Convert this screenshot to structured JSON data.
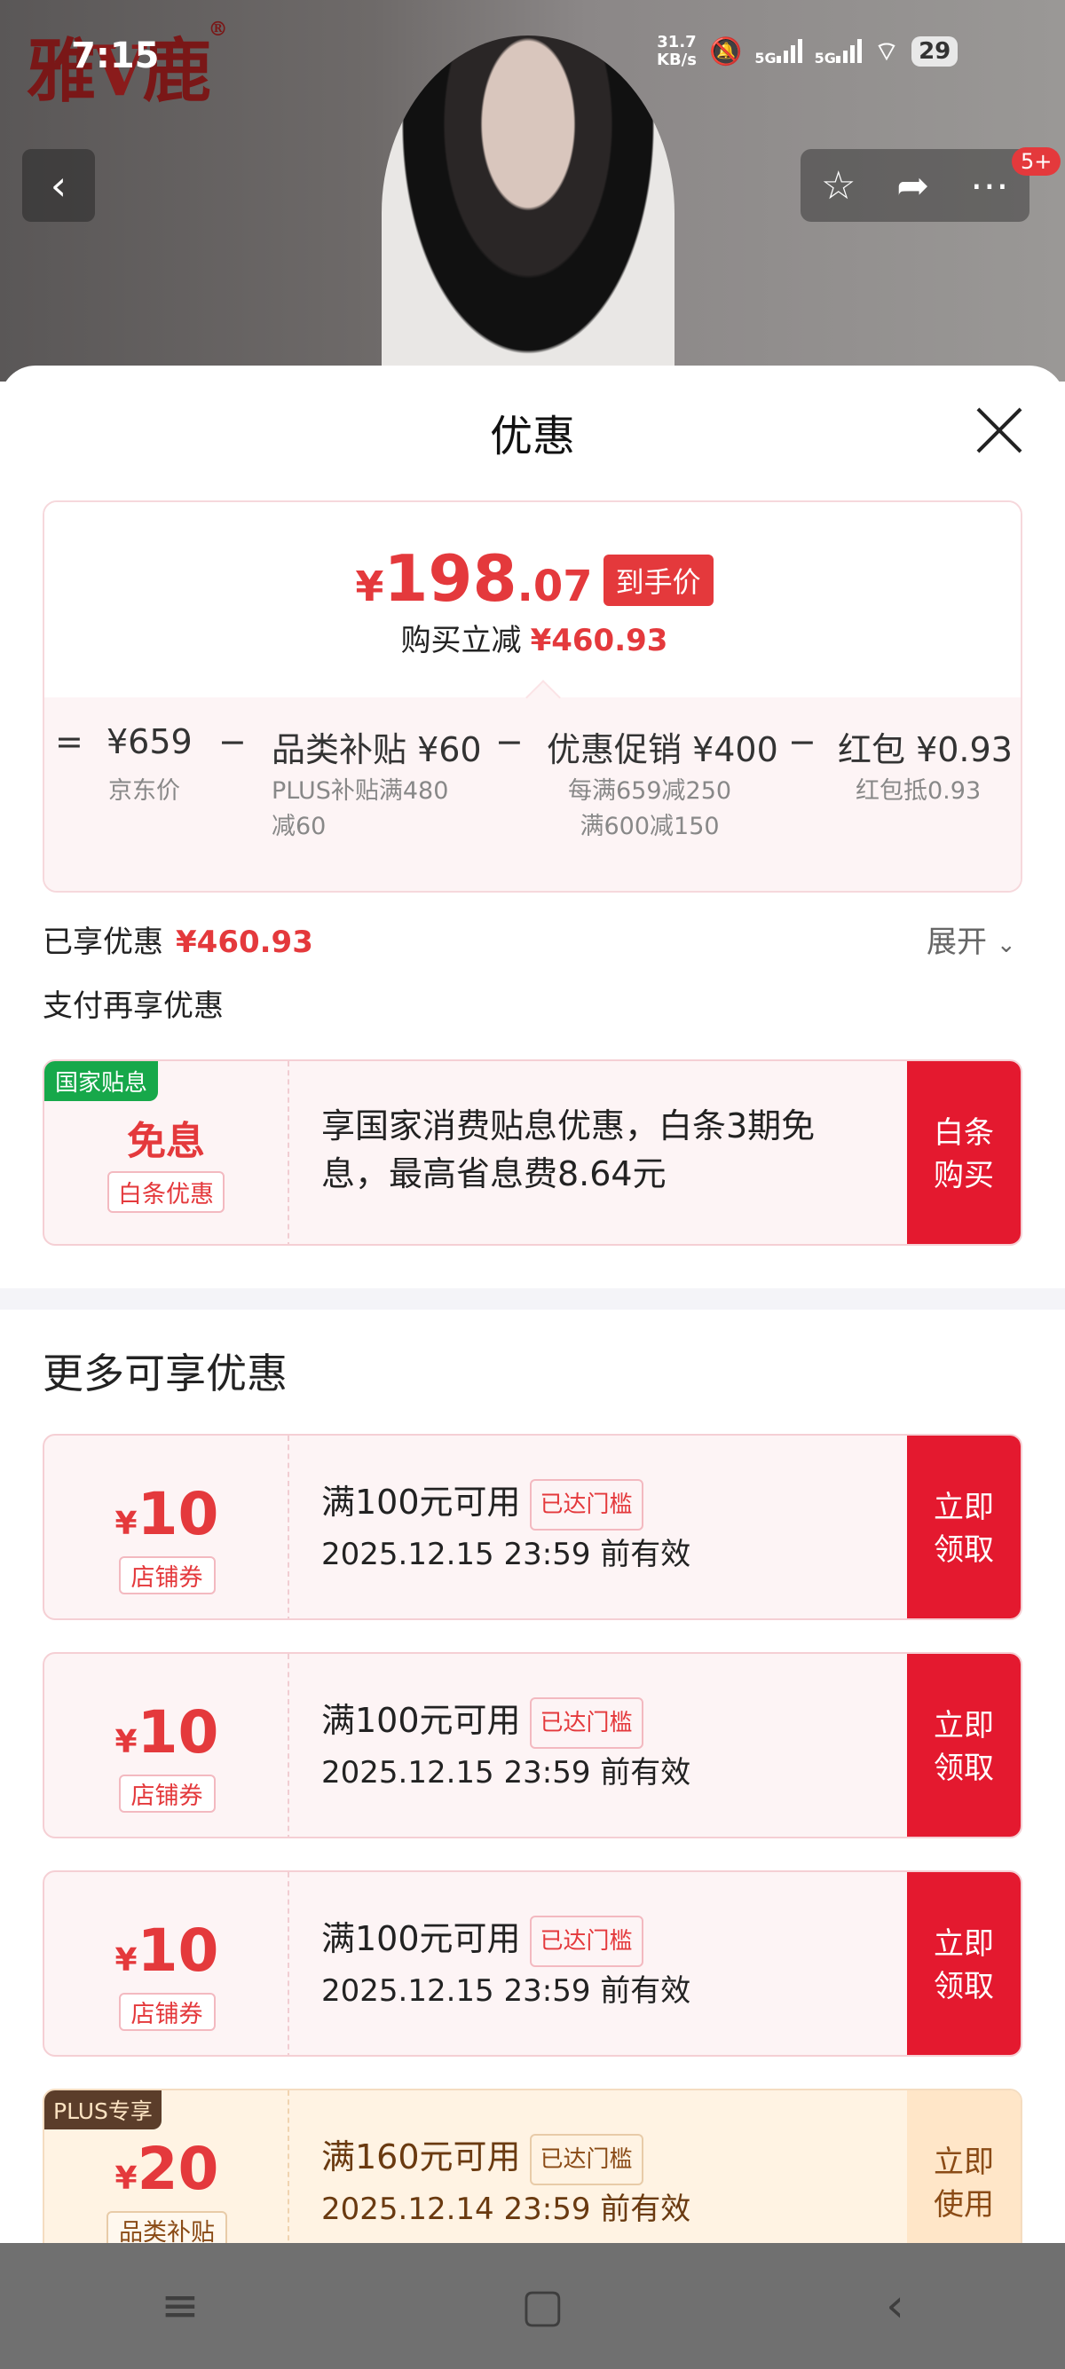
{
  "status": {
    "time": "7:15",
    "speed": "31.7\nKB/s",
    "battery": "29",
    "net1": "5G",
    "net2": "5G"
  },
  "header": {
    "brand": "雅",
    "brand_v": "V",
    "brand2": "鹿",
    "reg": "®",
    "notify_badge": "5+"
  },
  "sheet": {
    "title": "优惠"
  },
  "price": {
    "currency": "¥",
    "int": "198",
    "dec": ".07",
    "tag": "到手价",
    "buy_off_label": "购买立减",
    "buy_off_value": "¥460.93",
    "eq": "=",
    "minus": "−",
    "items": [
      {
        "main": "¥659",
        "sub": "京东价"
      },
      {
        "main": "品类补贴 ¥60",
        "sub": "PLUS补贴满480\n减60"
      },
      {
        "main": "优惠促销 ¥400",
        "sub": "每满659减250\n满600减150"
      },
      {
        "main": "红包 ¥0.93",
        "sub": "红包抵0.93"
      }
    ]
  },
  "enjoyed": {
    "label": "已享优惠",
    "value": "¥460.93",
    "expand": "展开"
  },
  "pay_again": "支付再享优惠",
  "baitiao": {
    "corner": "国家贴息",
    "title": "免息",
    "tag": "白条优惠",
    "desc": "享国家消费贴息优惠，白条3期免\n息，最高省息费8.64元",
    "button": "白条\n购买"
  },
  "more_title": "更多可享优惠",
  "coupons": [
    {
      "currency": "¥",
      "amount": "10",
      "type": "店铺券",
      "condition": "满100元可用",
      "reach": "已达门槛",
      "valid": "2025.12.15 23:59 前有效",
      "button": "立即\n领取"
    },
    {
      "currency": "¥",
      "amount": "10",
      "type": "店铺券",
      "condition": "满100元可用",
      "reach": "已达门槛",
      "valid": "2025.12.15 23:59 前有效",
      "button": "立即\n领取"
    },
    {
      "currency": "¥",
      "amount": "10",
      "type": "店铺券",
      "condition": "满100元可用",
      "reach": "已达门槛",
      "valid": "2025.12.15 23:59 前有效",
      "button": "立即\n领取"
    }
  ],
  "plus_coupon": {
    "corner": "PLUS专享",
    "currency": "¥",
    "amount": "20",
    "type": "品类补贴",
    "condition": "满160元可用",
    "reach": "已达门槛",
    "valid": "2025.12.14 23:59 前有效",
    "button": "立即\n使用"
  },
  "nav": {
    "menu": "≡",
    "home": "▢",
    "back": "‹"
  },
  "colors": {
    "accent": "#e4393c",
    "gold": "#fff3e3",
    "green_tag": "#17a84a"
  }
}
